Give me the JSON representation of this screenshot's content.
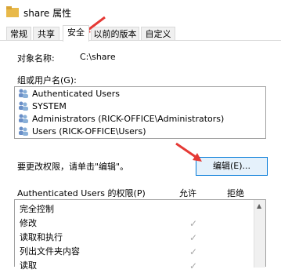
{
  "window": {
    "title": "share 属性"
  },
  "tabs": [
    {
      "label": "常规"
    },
    {
      "label": "共享"
    },
    {
      "label": "安全"
    },
    {
      "label": "以前的版本"
    },
    {
      "label": "自定义"
    }
  ],
  "object": {
    "label": "对象名称:",
    "value": "C:\\share"
  },
  "groups": {
    "label": "组或用户名(G):",
    "items": [
      "Authenticated Users",
      "SYSTEM",
      "Administrators (RICK-OFFICE\\Administrators)",
      "Users (RICK-OFFICE\\Users)"
    ]
  },
  "edit_hint": "要更改权限，请单击\"编辑\"。",
  "edit_button": "编辑(E)...",
  "permissions": {
    "title": "Authenticated Users 的权限(P)",
    "allow_header": "允许",
    "deny_header": "拒绝",
    "rows": [
      {
        "name": "完全控制",
        "allow": ""
      },
      {
        "name": "修改",
        "allow": "✓"
      },
      {
        "name": "读取和执行",
        "allow": "✓"
      },
      {
        "name": "列出文件夹内容",
        "allow": "✓"
      },
      {
        "name": "读取",
        "allow": "✓"
      }
    ]
  },
  "colors": {
    "accent": "#0078d7",
    "arrow": "#e53935",
    "check": "#a8a8a8"
  },
  "icons": [
    "folder-icon",
    "user-group-icon",
    "checkmark-icon",
    "scroll-up-icon",
    "red-arrow-annotation"
  ]
}
